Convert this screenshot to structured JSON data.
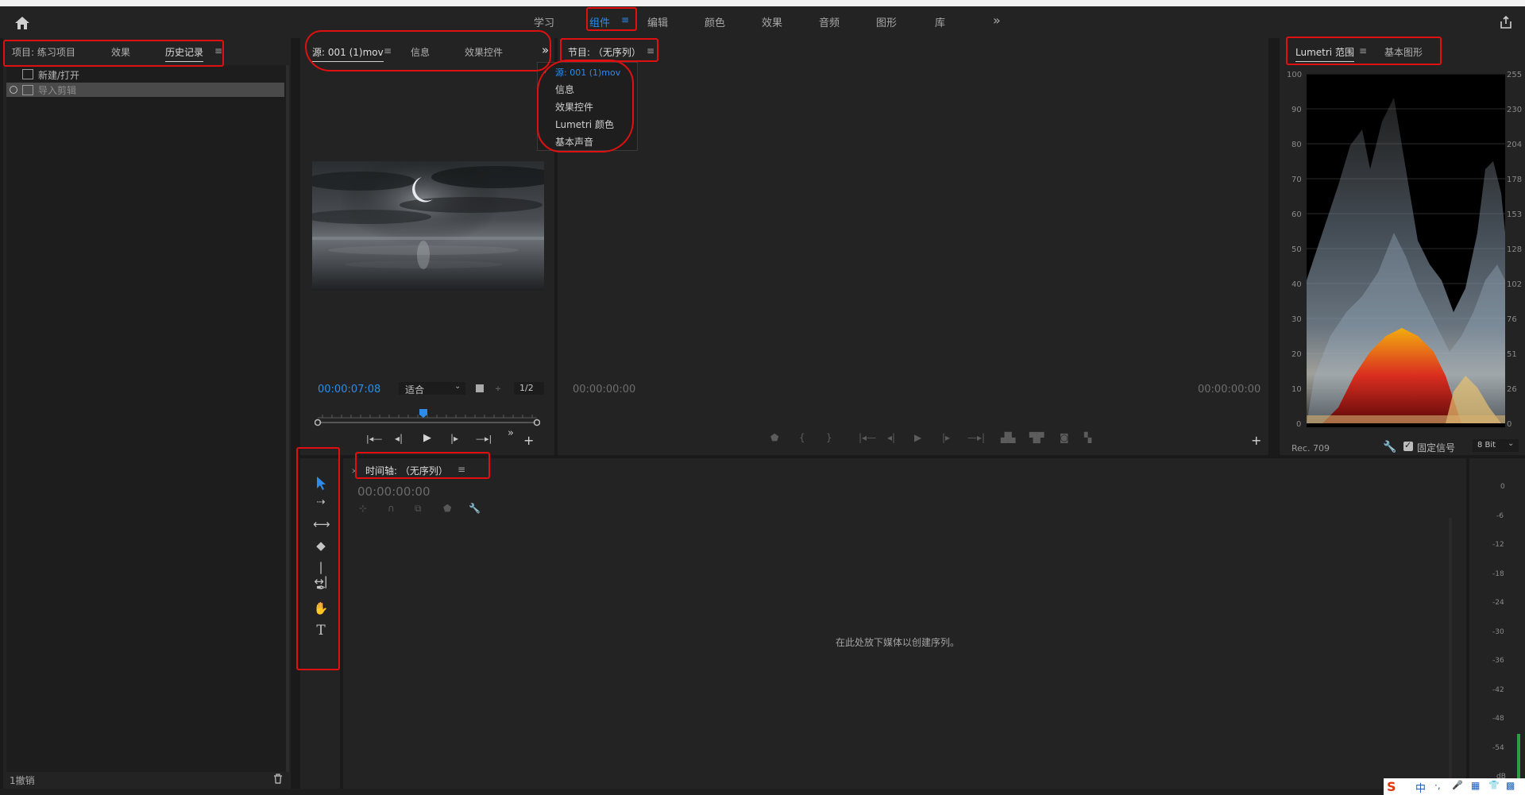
{
  "workspaces": {
    "tabs": [
      "学习",
      "组件",
      "编辑",
      "颜色",
      "效果",
      "音频",
      "图形",
      "库"
    ],
    "active": "组件",
    "more": "»"
  },
  "project_panel": {
    "tabs": [
      "项目: 练习项目",
      "效果",
      "历史记录"
    ],
    "active_tab": "历史记录",
    "history": [
      "新建/打开",
      "导入剪辑"
    ],
    "footer": "1撤销"
  },
  "source_panel": {
    "tabs": [
      "源: 001 (1)mov",
      "信息",
      "效果控件"
    ],
    "timecode": "00:00:07:08",
    "fit": "适合",
    "resolution": "1/2"
  },
  "program_panel": {
    "tab": "节目: （无序列）",
    "timecode_left": "00:00:00:00",
    "timecode_right": "00:00:00:00"
  },
  "dropdown": {
    "items": [
      "源: 001 (1)mov",
      "信息",
      "效果控件",
      "Lumetri 颜色",
      "基本声音"
    ],
    "checked_index": 0
  },
  "lumetri": {
    "tabs": [
      "Lumetri 范围",
      "基本图形"
    ],
    "left_axis": [
      "100",
      "90",
      "80",
      "70",
      "60",
      "50",
      "40",
      "30",
      "20",
      "10",
      "0"
    ],
    "right_axis": [
      "255",
      "230",
      "204",
      "178",
      "153",
      "128",
      "102",
      "76",
      "51",
      "26",
      "0"
    ],
    "colorspace": "Rec. 709",
    "clamp_label": "固定信号",
    "bit_depth": "8 Bit"
  },
  "timeline": {
    "tab": "时间轴: （无序列）",
    "timecode": "00:00:00:00",
    "empty_text": "在此处放下媒体以创建序列。"
  },
  "audio_meter": {
    "scale": [
      "0",
      "-6",
      "-12",
      "-18",
      "-24",
      "-30",
      "-36",
      "-42",
      "-48",
      "-54",
      "dB"
    ]
  },
  "ime": {
    "items": [
      "S",
      "中",
      "·,",
      "🎤",
      "▦",
      "👕",
      "▩"
    ]
  },
  "colors": {
    "accent": "#2d8ceb",
    "annotation": "#e01010",
    "panel_bg": "#232323"
  }
}
